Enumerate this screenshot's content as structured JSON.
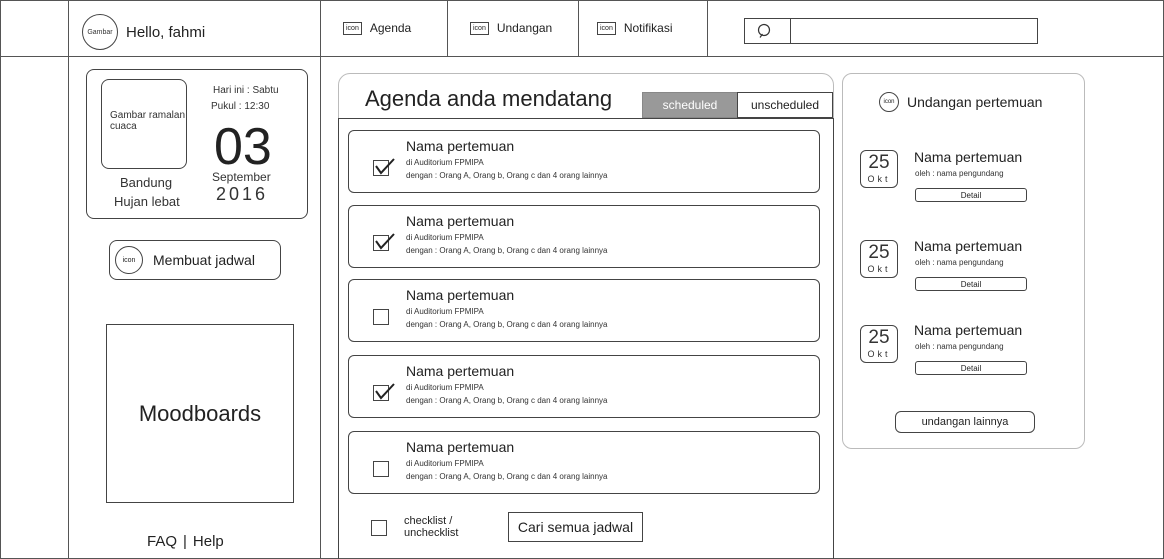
{
  "header": {
    "avatar_label": "Gambar",
    "greeting": "Hello, fahmi",
    "tabs": [
      {
        "icon_text": "icon",
        "label": "Agenda"
      },
      {
        "icon_text": "icon",
        "label": "Undangan"
      },
      {
        "icon_text": "icon",
        "label": "Notifikasi"
      }
    ],
    "search": {
      "placeholder": "",
      "icon": "search-icon"
    }
  },
  "weather": {
    "image_placeholder": "Gambar ramalan cuaca",
    "city": "Bandung",
    "condition": "Hujan lebat",
    "today": "Hari ini : Sabtu",
    "time": "Pukul : 12:30",
    "day": "03",
    "month": "September",
    "year": "2016"
  },
  "sidebar": {
    "create_button": {
      "icon_text": "icon",
      "label": "Membuat jadwal"
    },
    "moodboards": "Moodboards",
    "faq": "FAQ",
    "separator": "|",
    "help": "Help"
  },
  "agenda": {
    "title": "Agenda anda mendatang",
    "filters": {
      "active": "scheduled",
      "inactive": "unscheduled"
    },
    "items": [
      {
        "title": "Nama pertemuan",
        "location": "di Auditorium FPMIPA",
        "with": "dengan : Orang A, Orang b, Orang c dan 4 orang lainnya",
        "checked": true
      },
      {
        "title": "Nama pertemuan",
        "location": "di Auditorium FPMIPA",
        "with": "dengan : Orang A, Orang b, Orang c dan 4 orang lainnya",
        "checked": true
      },
      {
        "title": "Nama pertemuan",
        "location": "di Auditorium FPMIPA",
        "with": "dengan : Orang A, Orang b, Orang c dan 4 orang lainnya",
        "checked": false
      },
      {
        "title": "Nama pertemuan",
        "location": "di Auditorium FPMIPA",
        "with": "dengan : Orang A, Orang b, Orang c dan 4 orang lainnya",
        "checked": true
      },
      {
        "title": "Nama pertemuan",
        "location": "di Auditorium FPMIPA",
        "with": "dengan : Orang A, Orang b, Orang c dan 4 orang lainnya",
        "checked": false
      }
    ],
    "footer": {
      "checklist_label": "checklist / unchecklist",
      "search_all_button": "Cari semua jadwal"
    }
  },
  "invitations": {
    "icon_text": "icon",
    "title": "Undangan pertemuan",
    "items": [
      {
        "day": "25",
        "month": "Okt",
        "title": "Nama pertemuan",
        "by": "oleh : nama pengundang",
        "button": "Detail"
      },
      {
        "day": "25",
        "month": "Okt",
        "title": "Nama pertemuan",
        "by": "oleh : nama pengundang",
        "button": "Detail"
      },
      {
        "day": "25",
        "month": "Okt",
        "title": "Nama pertemuan",
        "by": "oleh : nama pengundang",
        "button": "Detail"
      }
    ],
    "more_button": "undangan lainnya"
  }
}
